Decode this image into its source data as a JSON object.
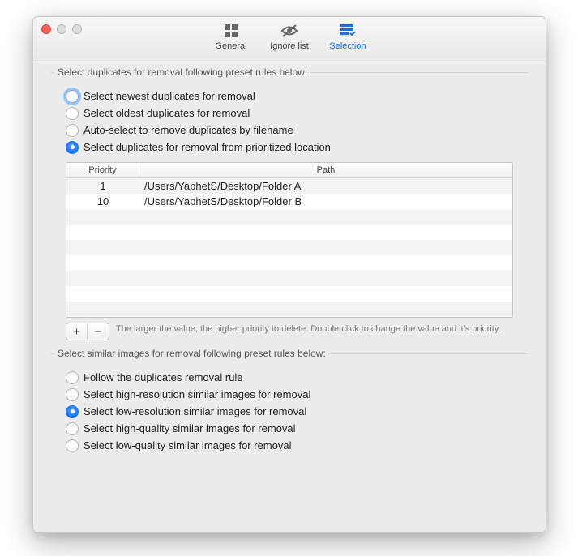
{
  "toolbar": {
    "general": "General",
    "ignore": "Ignore list",
    "selection": "Selection"
  },
  "group1": {
    "title": "Select duplicates for removal following preset rules below:",
    "opt_newest": "Select newest duplicates for removal",
    "opt_oldest": "Select oldest duplicates for removal",
    "opt_filename": "Auto-select to remove duplicates by filename",
    "opt_location": "Select duplicates for removal from prioritized location",
    "table": {
      "col_priority": "Priority",
      "col_path": "Path",
      "rows": [
        {
          "priority": "1",
          "path": "/Users/YaphetS/Desktop/Folder A"
        },
        {
          "priority": "10",
          "path": "/Users/YaphetS/Desktop/Folder B"
        }
      ]
    },
    "hint": "The larger the value, the higher priority to delete.  Double click to change the value and it's priority.",
    "add_label": "+",
    "remove_label": "−"
  },
  "group2": {
    "title": "Select similar images for removal following preset rules below:",
    "opt_follow": "Follow the duplicates removal rule",
    "opt_highres": "Select high-resolution similar images for removal",
    "opt_lowres": "Select low-resolution similar images for removal",
    "opt_highq": "Select high-quality similar images for removal",
    "opt_lowq": "Select low-quality similar images for removal"
  }
}
